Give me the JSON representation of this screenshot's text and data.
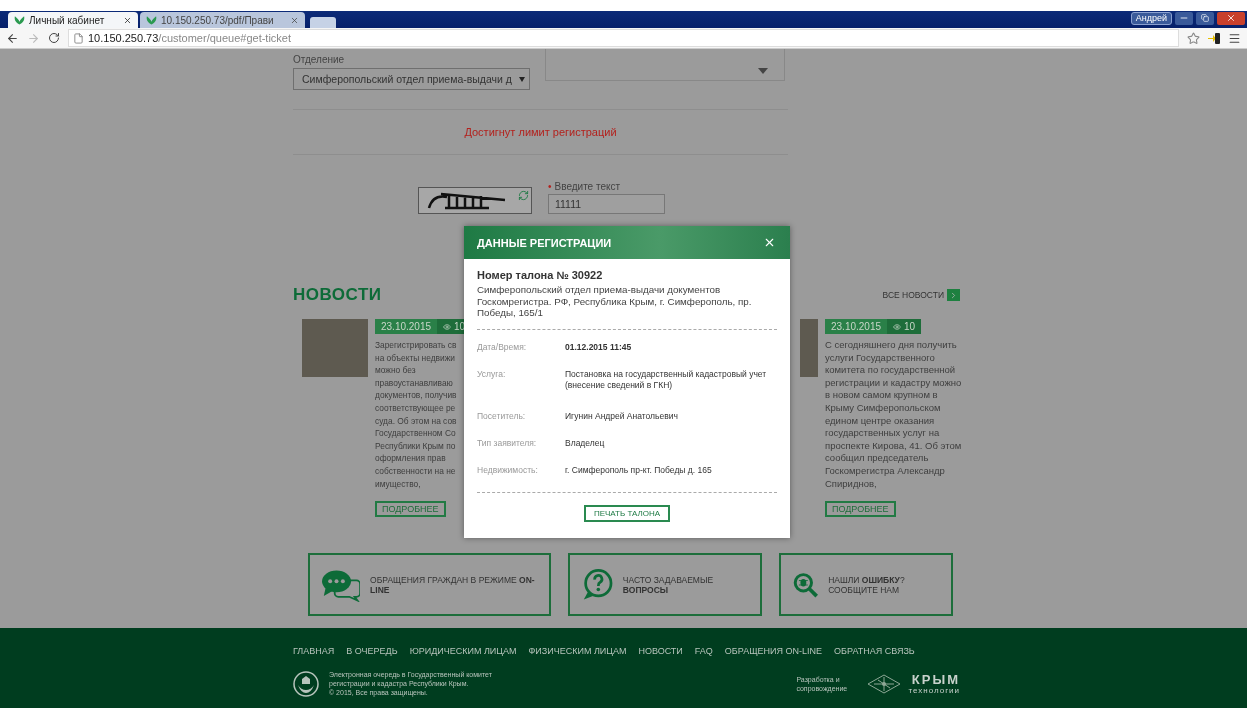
{
  "browser": {
    "tabs": [
      {
        "title": "Личный кабинет",
        "selected": true
      },
      {
        "title": "10.150.250.73/pdf/Прави",
        "selected": false
      }
    ],
    "user": "Андрей",
    "url_host": "10.150.250.73",
    "url_path": "/customer/queue#get-ticket"
  },
  "form": {
    "department_label": "Отделение",
    "department_value": "Симферопольский отдел приема-выдачи д",
    "limit_message": "Достигнут лимит регистраций",
    "captcha_label": "Введите текст",
    "required_mark": "•",
    "captcha_value": "11111"
  },
  "news": {
    "title": "НОВОСТИ",
    "all_link": "ВСЕ НОВОСТИ",
    "items": [
      {
        "date": "23.10.2015",
        "views": "10",
        "lines": [
          "Зарегистрировать св",
          "на объекты недвижи",
          "можно без",
          "правоустанавливаю",
          "документов, получив",
          "соответствующее ре",
          "суда. Об этом на сов",
          "Государственном Со",
          "Республики Крым по",
          "оформления прав",
          "собственности на не",
          "имущество,"
        ],
        "more": "ПОДРОБНЕЕ"
      },
      {
        "date": "23.10.2015",
        "views": "10",
        "lines": [
          "С сегодняшнего дня получить",
          "услуги Государственного",
          "комитета по государственной",
          "регистрации и кадастру можно",
          "в новом самом крупном в",
          "Крыму Симферопольском",
          "едином центре оказания",
          "государственных услуг на",
          "проспекте Кирова, 41. Об этом",
          "сообщил председатель",
          "Госкомрегистра Александр",
          "Спириднов,"
        ],
        "more": "ПОДРОБНЕЕ"
      }
    ]
  },
  "links": [
    {
      "kind": "chat",
      "text": "ОБРАЩЕНИЯ ГРАЖДАН В РЕЖИМЕ **ON-LINE**"
    },
    {
      "kind": "question",
      "text": "ЧАСТО ЗАДАВАЕМЫЕ **ВОПРОСЫ**"
    },
    {
      "kind": "bug",
      "text": "НАШЛИ **ОШИБКУ**? СООБЩИТЕ НАМ"
    }
  ],
  "modal": {
    "title": "ДАННЫЕ РЕГИСТРАЦИИ",
    "ticket": "Номер талона № 30922",
    "address": "Симферопольский отдел приема-выдачи документов Госкомрегистра. РФ, Республика Крым, г. Симферополь, пр. Победы, 165/1",
    "rows": [
      {
        "label": "Дата/Время:",
        "value": "01.12.2015 11:45",
        "emphasis": true
      },
      {
        "label": "Услуга:",
        "value": "Постановка на государственный кадастровый учет (внесение сведений в ГКН)",
        "emphasis": false
      },
      {
        "label": "Посетитель:",
        "value": "Игунин Андрей Анатольевич",
        "emphasis": false
      },
      {
        "label": "Тип заявителя:",
        "value": "Владелец",
        "emphasis": false
      },
      {
        "label": "Недвижимость:",
        "value": "г. Симферополь пр-кт. Победы д. 165",
        "emphasis": false
      }
    ],
    "print_button": "ПЕЧАТЬ ТАЛОНА"
  },
  "footer": {
    "nav": [
      "ГЛАВНАЯ",
      "В ОЧЕРЕДЬ",
      "ЮРИДИЧЕСКИМ ЛИЦАМ",
      "ФИЗИЧЕСКИМ ЛИЦАМ",
      "НОВОСТИ",
      "FAQ",
      "ОБРАЩЕНИЯ ON-LINE",
      "ОБРАТНАЯ СВЯЗЬ"
    ],
    "about_lines": [
      "Электронная очередь в Государственный комитет",
      "регистрации и кадастра Республики Крым.",
      "© 2015, Все права защищены."
    ],
    "developer_label": "Разработка и сопровождение",
    "developer_name": "КРЫМ",
    "developer_sub": "технологии"
  }
}
